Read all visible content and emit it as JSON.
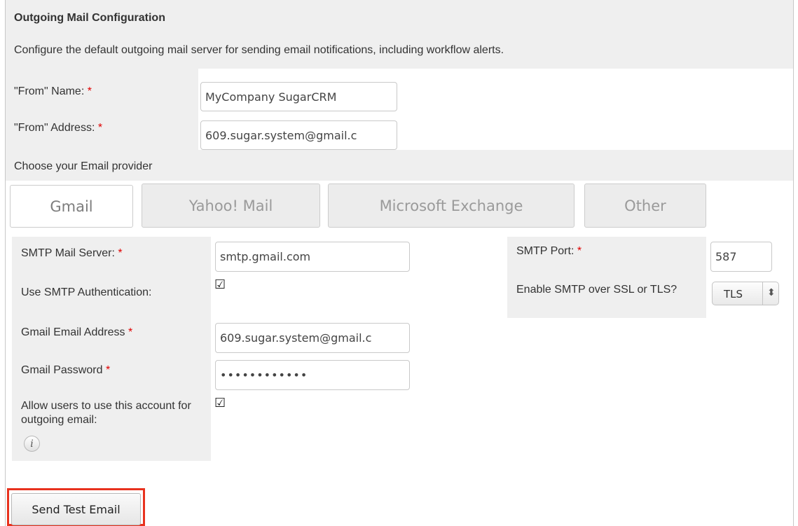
{
  "section": {
    "title": "Outgoing Mail Configuration",
    "description": "Configure the default outgoing mail server for sending email notifications, including workflow alerts."
  },
  "required_mark": "*",
  "from_name": {
    "label": "\"From\" Name:",
    "value": "MyCompany SugarCRM"
  },
  "from_address": {
    "label": "\"From\" Address:",
    "value": "609.sugar.system@gmail.c"
  },
  "provider": {
    "heading": "Choose your Email provider",
    "tabs": [
      "Gmail",
      "Yahoo! Mail",
      "Microsoft Exchange",
      "Other"
    ],
    "selected": "Gmail"
  },
  "smtp": {
    "server_label": "SMTP Mail Server:",
    "server_value": "smtp.gmail.com",
    "auth_label": "Use SMTP Authentication:",
    "auth_checked": true,
    "port_label": "SMTP Port:",
    "port_value": "587",
    "ssl_label": "Enable SMTP over SSL or TLS?",
    "ssl_value": "TLS",
    "email_label": "Gmail Email Address",
    "email_value": "609.sugar.system@gmail.c",
    "password_label": "Gmail Password",
    "password_value": "••••••••••••",
    "allow_label": "Allow users to use this account for outgoing email:",
    "allow_checked": true,
    "check_glyph": "☑",
    "info_glyph": "i",
    "select_arrow": "⬍"
  },
  "actions": {
    "send_test": "Send Test Email"
  },
  "colors": {
    "required": "#e00000",
    "highlight": "#e8321e",
    "panel": "#efefef"
  }
}
